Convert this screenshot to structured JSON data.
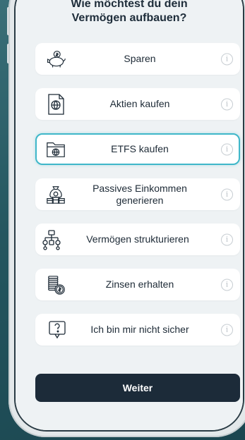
{
  "heading": {
    "line1": "Wie möchtest du dein",
    "line2": "Vermögen aufbauen?"
  },
  "options": [
    {
      "label": "Sparen",
      "icon": "piggy-bank-icon"
    },
    {
      "label": "Aktien  kaufen",
      "icon": "globe-document-icon"
    },
    {
      "label": "ETFS kaufen",
      "icon": "globe-folder-icon",
      "selected": true
    },
    {
      "label": "Passives Einkommen generieren",
      "icon": "money-bag-icon"
    },
    {
      "label": "Vermögen strukturieren",
      "icon": "hierarchy-icon"
    },
    {
      "label": "Zinsen erhalten",
      "icon": "coin-stack-icon"
    },
    {
      "label": "Ich bin mir nicht sicher",
      "icon": "question-bubble-icon"
    }
  ],
  "info_glyph": "i",
  "continue_label": "Weiter",
  "colors": {
    "accent": "#3fb7c9",
    "button": "#1c2b39",
    "text": "#1d2a36"
  }
}
